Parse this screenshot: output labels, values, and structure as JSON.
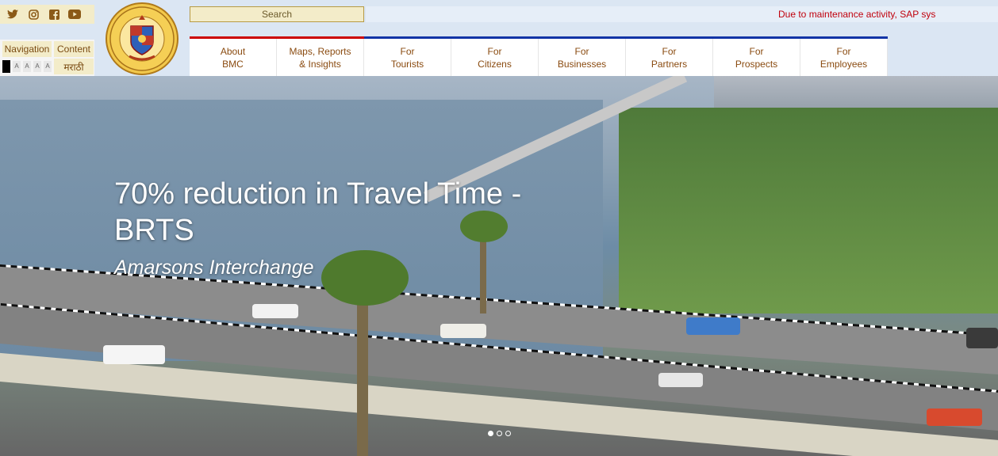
{
  "social": [
    "twitter-icon",
    "instagram-icon",
    "facebook-icon",
    "youtube-icon"
  ],
  "accessibility": {
    "navigation_label": "Navigation",
    "content_label": "Content",
    "font_sizes": [
      "A",
      "A",
      "A",
      "A"
    ],
    "language_label": "मराठी"
  },
  "logo": {
    "arc_text_top": "बृहन्मुंबई महानगरपालिका",
    "arc_text_bottom": "Brihanmumbai Municipal Corporation"
  },
  "search": {
    "label": "Search"
  },
  "ticker": {
    "text": "Due to maintenance activity, SAP sys"
  },
  "nav": {
    "items": [
      {
        "line1": "About",
        "line2": "BMC"
      },
      {
        "line1": "Maps, Reports",
        "line2": "& Insights"
      },
      {
        "line1": "For",
        "line2": "Tourists"
      },
      {
        "line1": "For",
        "line2": "Citizens"
      },
      {
        "line1": "For",
        "line2": "Businesses"
      },
      {
        "line1": "For",
        "line2": "Partners"
      },
      {
        "line1": "For",
        "line2": "Prospects"
      },
      {
        "line1": "For",
        "line2": "Employees"
      }
    ]
  },
  "hero": {
    "title": "70% reduction in Travel Time - BRTS",
    "subtitle": "Amarsons Interchange",
    "slides": 3,
    "active_slide": 1
  },
  "colors": {
    "accent_red": "#c00000",
    "accent_blue": "#1234a6",
    "nav_text": "#8a4b10",
    "ticker_text": "#c0000c"
  }
}
